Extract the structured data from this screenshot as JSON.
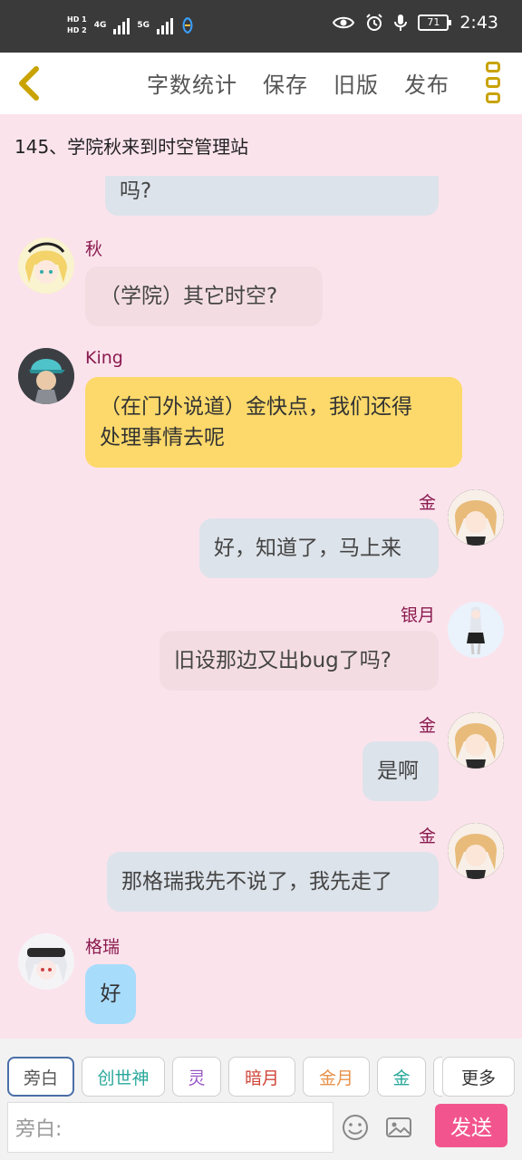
{
  "status_bar": {
    "hd1": "HD 1",
    "hd2": "HD 2",
    "net1": "4G",
    "net2": "5G",
    "battery": "71",
    "time": "2:43"
  },
  "header": {
    "menu": [
      "字数统计",
      "保存",
      "旧版",
      "发布"
    ]
  },
  "story_title": "145、学院秋来到时空管理站",
  "messages": [
    {
      "side": "right",
      "name": "",
      "text": "吗?",
      "bubble": "gray",
      "partial": true
    },
    {
      "side": "left",
      "name": "秋",
      "text": "（学院）其它时空?",
      "bubble": "pink"
    },
    {
      "side": "left",
      "name": "King",
      "text_lines": [
        "（在门外说道）金快点，我们还得",
        "处理事情去呢"
      ],
      "bubble": "yellow"
    },
    {
      "side": "right",
      "name": "金",
      "text": "好，知道了，马上来",
      "bubble": "gray"
    },
    {
      "side": "right",
      "name": "银月",
      "text": "旧设那边又出bug了吗?",
      "bubble": "pink"
    },
    {
      "side": "right",
      "name": "金",
      "text": "是啊",
      "bubble": "gray"
    },
    {
      "side": "right",
      "name": "金",
      "text": "那格瑞我先不说了，我先走了",
      "bubble": "gray"
    },
    {
      "side": "left",
      "name": "格瑞",
      "text": "好",
      "bubble": "blue"
    }
  ],
  "characters": [
    {
      "label": "旁白",
      "color": "#555555",
      "selected": true
    },
    {
      "label": "创世神",
      "color": "#2aa89a"
    },
    {
      "label": "灵",
      "color": "#9a58c8"
    },
    {
      "label": "暗月",
      "color": "#d0473a"
    },
    {
      "label": "金月",
      "color": "#e8924a"
    },
    {
      "label": "金",
      "color": "#2aa89a"
    }
  ],
  "more_label": "更多",
  "input": {
    "placeholder": "旁白:"
  },
  "send_label": "发送",
  "colors": {
    "accent": "#f2558d",
    "name": "#8a1a4e",
    "background": "#fbe3ec",
    "back_arrow": "#c9a300"
  }
}
